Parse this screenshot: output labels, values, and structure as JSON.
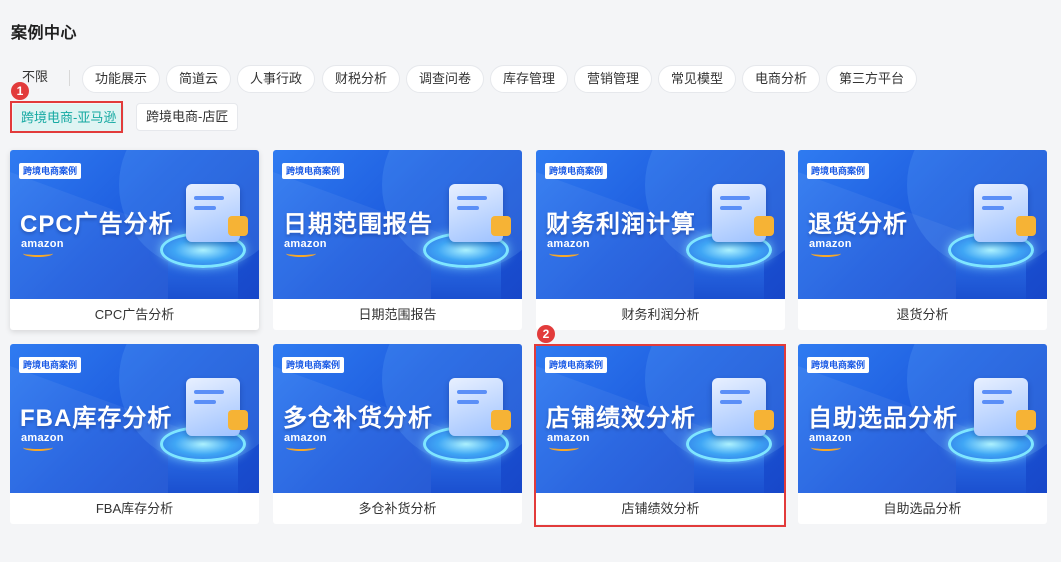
{
  "page": {
    "title": "案例中心"
  },
  "filters": {
    "row1": [
      "不限",
      "功能展示",
      "简道云",
      "人事行政",
      "财税分析",
      "调查问卷",
      "库存管理",
      "营销管理",
      "常见模型",
      "电商分析",
      "第三方平台"
    ],
    "row2": [
      "跨境电商-亚马逊",
      "跨境电商-店匠"
    ],
    "active": "跨境电商-亚马逊"
  },
  "annotations": {
    "badge1": "1",
    "badge2": "2",
    "highlight_color": "#e23b3b"
  },
  "cards": [
    {
      "tag": "跨境电商案例",
      "big": "CPC广告分析",
      "brand": "amazon",
      "caption": "CPC广告分析"
    },
    {
      "tag": "跨境电商案例",
      "big": "日期范围报告",
      "brand": "amazon",
      "caption": "日期范围报告"
    },
    {
      "tag": "跨境电商案例",
      "big": "财务利润计算",
      "brand": "amazon",
      "caption": "财务利润分析"
    },
    {
      "tag": "跨境电商案例",
      "big": "退货分析",
      "brand": "amazon",
      "caption": "退货分析"
    },
    {
      "tag": "跨境电商案例",
      "big": "FBA库存分析",
      "brand": "amazon",
      "caption": "FBA库存分析"
    },
    {
      "tag": "跨境电商案例",
      "big": "多仓补货分析",
      "brand": "amazon",
      "caption": "多仓补货分析"
    },
    {
      "tag": "跨境电商案例",
      "big": "店铺绩效分析",
      "brand": "amazon",
      "caption": "店铺绩效分析"
    },
    {
      "tag": "跨境电商案例",
      "big": "自助选品分析",
      "brand": "amazon",
      "caption": "自助选品分析"
    }
  ],
  "colors": {
    "accent": "#16a9a2",
    "active_bg": "#dff4f3",
    "card_blue": "#1f5fe0"
  }
}
